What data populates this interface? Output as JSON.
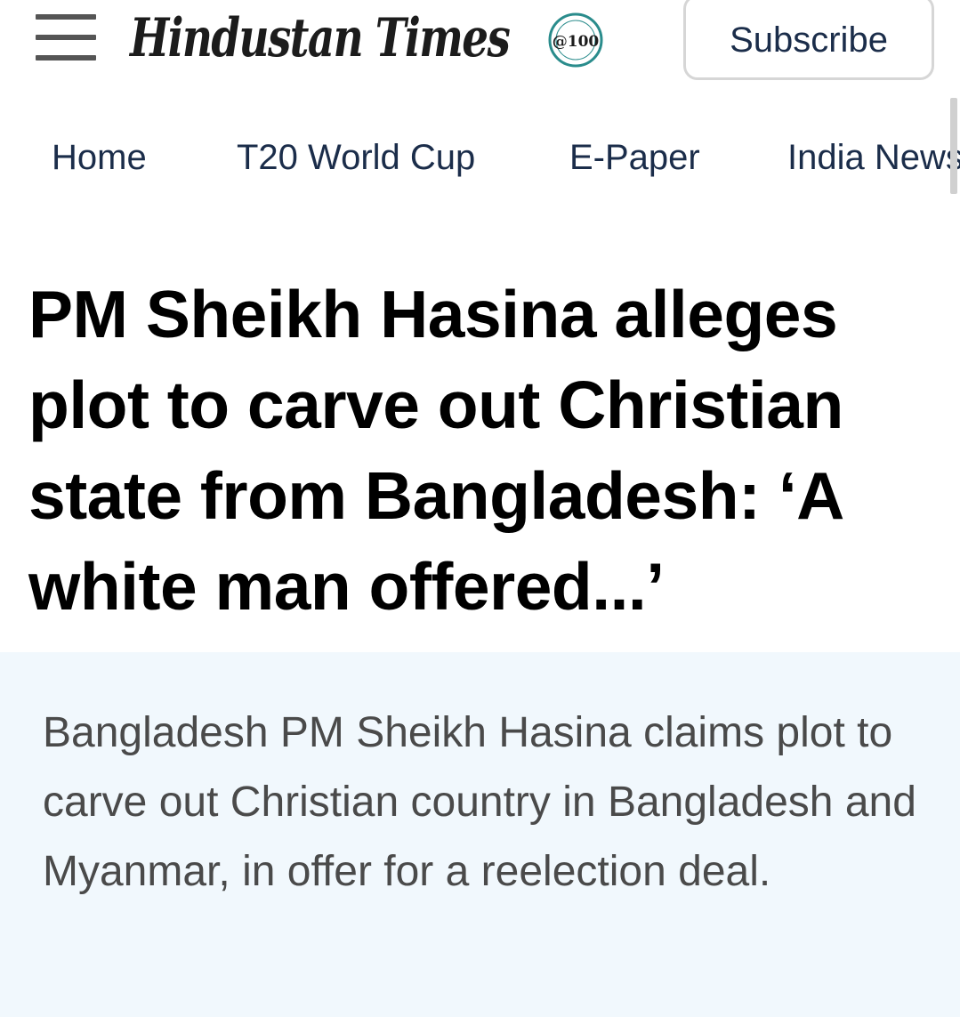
{
  "header": {
    "menu_icon": "hamburger-menu-icon",
    "logo_text": "Hindustan Times",
    "logo_badge_text": "@100",
    "subscribe_label": "Subscribe"
  },
  "nav": {
    "items": [
      {
        "label": "Home"
      },
      {
        "label": "T20 World Cup"
      },
      {
        "label": "E-Paper"
      },
      {
        "label": "India News"
      }
    ]
  },
  "article": {
    "headline": "PM Sheikh Hasina alleges plot to carve out Christian state from Bangladesh: ‘A white man offered...’",
    "summary": "Bangladesh PM Sheikh Hasina claims plot to carve out Christian country in Bangladesh and Myanmar, in offer for a reelection deal."
  },
  "colors": {
    "nav_text": "#1b2d4a",
    "summary_bg": "#f1f8fd",
    "badge_teal": "#2a8c8c"
  }
}
